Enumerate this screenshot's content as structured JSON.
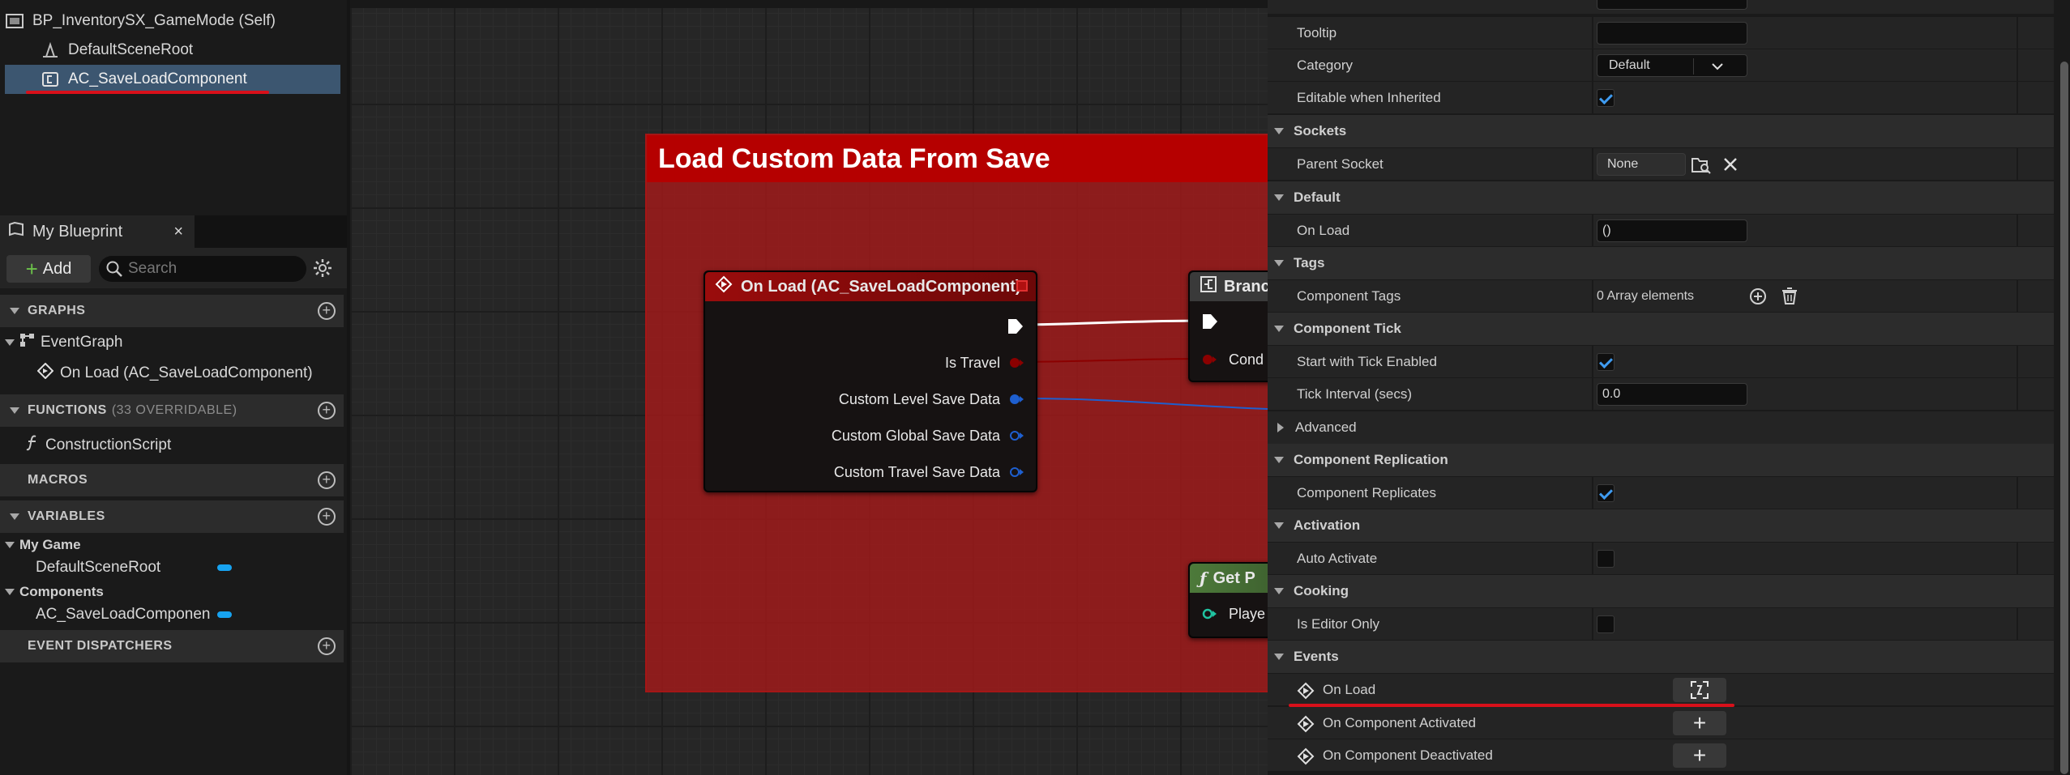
{
  "component_tree": {
    "root": "BP_InventorySX_GameMode (Self)",
    "items": [
      {
        "label": "DefaultSceneRoot",
        "icon": "scene-root-icon"
      },
      {
        "label": "AC_SaveLoadComponent",
        "icon": "actor-component-icon",
        "selected": true
      }
    ]
  },
  "my_blueprint": {
    "tab_label": "My Blueprint",
    "close_glyph": "×",
    "add_label": "Add",
    "search_placeholder": "Search",
    "sections": {
      "graphs": "GRAPHS",
      "functions": "FUNCTIONS",
      "functions_sub": "(33 OVERRIDABLE)",
      "macros": "MACROS",
      "variables": "VARIABLES",
      "event_dispatchers": "EVENT DISPATCHERS"
    },
    "graphs_items": {
      "event_graph": "EventGraph",
      "on_load": "On Load (AC_SaveLoadComponent)"
    },
    "functions_items": {
      "construction_script": "ConstructionScript"
    },
    "variables": {
      "cat1": "My Game",
      "cat1_item": "DefaultSceneRoot",
      "cat2": "Components",
      "cat2_item": "AC_SaveLoadComponen"
    }
  },
  "graph": {
    "comment_title": "Load Custom Data From Save",
    "event_node": {
      "title": "On Load (AC_SaveLoadComponent)",
      "pins": [
        "Is Travel",
        "Custom Level Save Data",
        "Custom Global Save Data",
        "Custom Travel Save Data"
      ]
    },
    "branch_node": {
      "title": "Branc",
      "pin": "Cond"
    },
    "get_node": {
      "title": "Get P",
      "pin": "Playe"
    }
  },
  "details": {
    "rows": {
      "tooltip": "Tooltip",
      "category": "Category",
      "category_value": "Default",
      "editable": "Editable when Inherited",
      "parent_socket": "Parent Socket",
      "parent_socket_value": "None",
      "on_load": "On Load",
      "on_load_value": "()",
      "component_tags": "Component Tags",
      "component_tags_value": "0 Array elements",
      "start_tick": "Start with Tick Enabled",
      "tick_interval": "Tick Interval (secs)",
      "tick_interval_value": "0.0",
      "component_replicates": "Component Replicates",
      "auto_activate": "Auto Activate",
      "is_editor_only": "Is Editor Only"
    },
    "categories": {
      "sockets": "Sockets",
      "default": "Default",
      "tags": "Tags",
      "component_tick": "Component Tick",
      "advanced": "Advanced",
      "component_replication": "Component Replication",
      "activation": "Activation",
      "cooking": "Cooking",
      "events": "Events"
    },
    "events": {
      "on_load": "On Load",
      "on_component_activated": "On Component Activated",
      "on_component_deactivated": "On Component Deactivated"
    },
    "checkboxes": {
      "editable_when_inherited": true,
      "start_with_tick_enabled": true,
      "component_replicates": true,
      "auto_activate": false,
      "is_editor_only": false
    }
  },
  "colors": {
    "annotation_red": "#d8101a",
    "selection_blue": "#3c5670",
    "exec_white": "#ffffff",
    "bool_red": "#8b0000",
    "struct_blue": "#1e5fcf",
    "comment_red": "#b50000"
  }
}
